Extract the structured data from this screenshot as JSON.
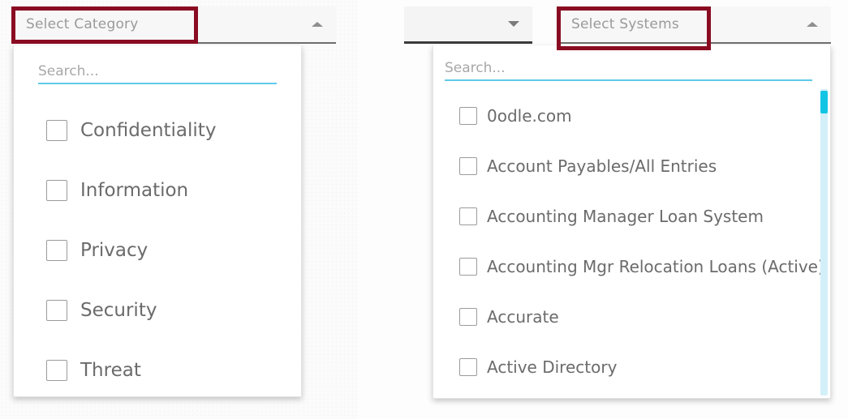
{
  "colors": {
    "highlight_box": "#8A0C22",
    "search_underline": "#5ECBE8",
    "scrollbar_thumb": "#12C5E4",
    "scrollbar_track": "#D3F0F9",
    "label_text": "#9A9A9A",
    "option_text": "#6B6B6B"
  },
  "category_dropdown": {
    "label": "Select Category",
    "caret": "caret-up-icon",
    "expanded": true,
    "search": {
      "value": "",
      "placeholder": "Search..."
    },
    "options": [
      {
        "label": "Confidentiality",
        "checked": false
      },
      {
        "label": "Information",
        "checked": false
      },
      {
        "label": "Privacy",
        "checked": false
      },
      {
        "label": "Security",
        "checked": false
      },
      {
        "label": "Threat",
        "checked": false
      }
    ]
  },
  "partial_dropdown": {
    "label": "",
    "caret": "caret-down-icon",
    "expanded": false
  },
  "systems_dropdown": {
    "label": "Select Systems",
    "caret": "caret-up-icon",
    "expanded": true,
    "search": {
      "value": "",
      "placeholder": "Search..."
    },
    "options": [
      {
        "label": "0odle.com",
        "checked": false
      },
      {
        "label": "Account Payables/All Entries",
        "checked": false
      },
      {
        "label": "Accounting Manager Loan System",
        "checked": false
      },
      {
        "label": "Accounting Mgr Relocation Loans (Active)",
        "checked": false
      },
      {
        "label": "Accurate",
        "checked": false
      },
      {
        "label": "Active Directory",
        "checked": false
      }
    ],
    "scrollbar": {
      "position": "top",
      "visible": true
    }
  },
  "annotations": [
    {
      "target": "Select Category",
      "shape": "rectangle"
    },
    {
      "target": "Select Systems",
      "shape": "rectangle"
    }
  ]
}
